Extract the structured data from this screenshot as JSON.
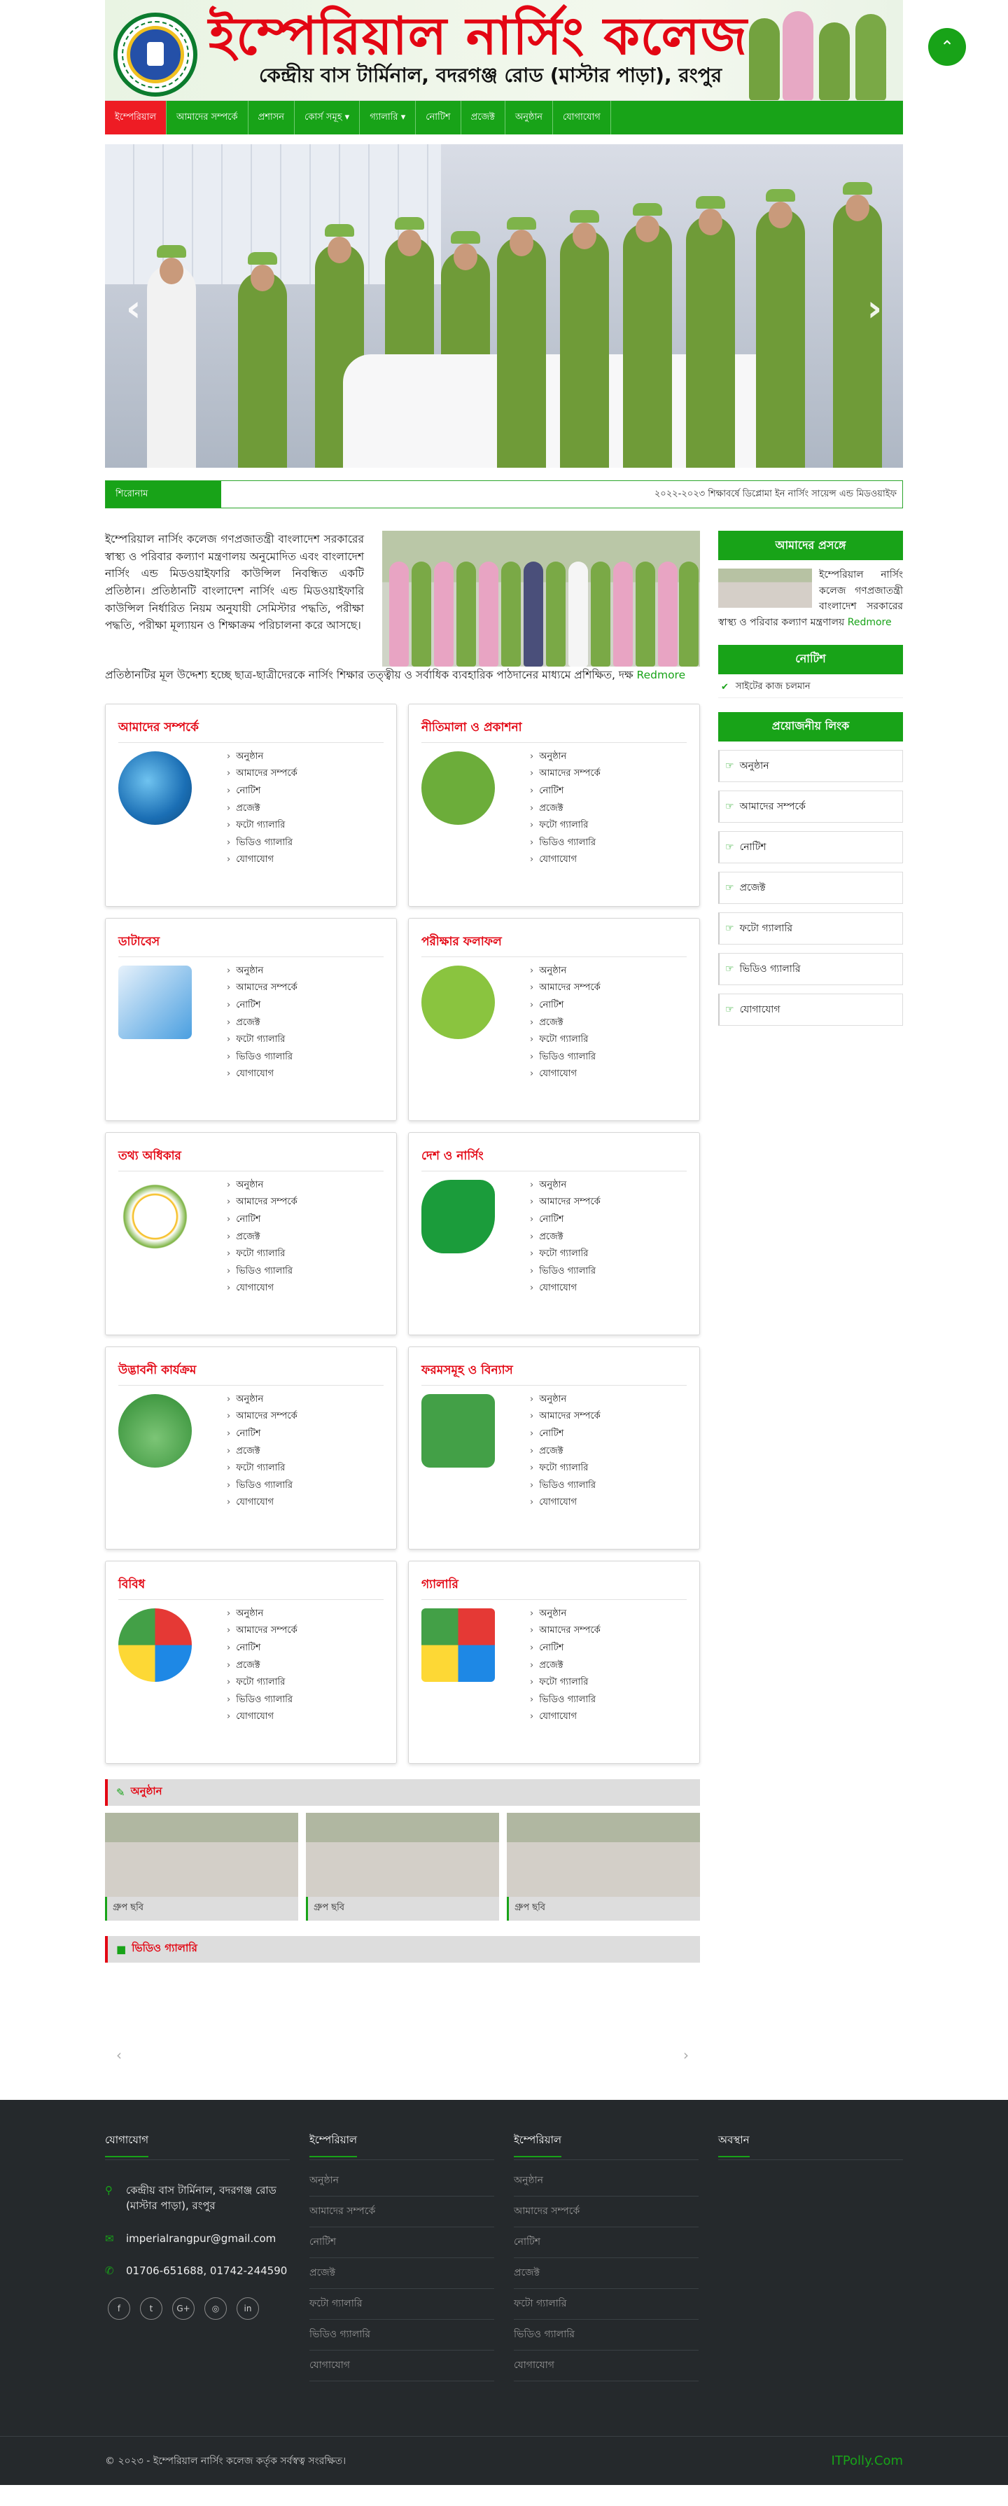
{
  "header": {
    "title": "ইম্পেরিয়াল নার্সিং কলেজ",
    "subtitle": "কেন্দ্রীয় বাস টার্মিনাল, বদরগঞ্জ রোড (মাস্টার পাড়া), রংপুর"
  },
  "nav": {
    "items": [
      "ইম্পেরিয়াল",
      "আমাদের সম্পর্কে",
      "প্রশাসন",
      "কোর্স সমূহ ▾",
      "গ্যালারি ▾",
      "নোটিশ",
      "প্রজেক্ট",
      "অনুষ্ঠান",
      "যোগাযোগ"
    ]
  },
  "slider": {
    "prev": "‹",
    "next": "›"
  },
  "ticker": {
    "label": "শিরোনাম",
    "text": "২০২২-২০২৩ শিক্ষাবর্ষে ডিপ্লোমা ইন নার্সিং সায়েন্স এন্ড মিডওয়াইফ"
  },
  "intro": {
    "text": "ইম্পেরিয়াল নার্সিং কলেজ গণপ্রজাতন্ত্রী বাংলাদেশ সরকারের স্বাস্থ্য ও পরিবার কল্যাণ মন্ত্রণালয় অনুমোদিত এবং বাংলাদেশ নার্সিং এন্ড মিডওয়াইফারি কাউন্সিল নিবন্ধিত একটি প্রতিষ্ঠান। প্রতিষ্ঠানটি বাংলাদেশ নার্সিং এন্ড মিডওয়াইফারি কাউন্সিল নির্ধারিত নিয়ম অনুযায়ী সেমিস্টার পদ্ধতি, পরীক্ষা পদ্ধতি, পরীক্ষা মূল্যায়ন ও শিক্ষাক্রম পরিচালনা করে আসছে।",
    "tail": "প্রতিষ্ঠানটির মূল উদ্দেশ্য হচ্ছে ছাত্র-ছাত্রীদেরকে নার্সিং শিক্ষার তত্ত্বীয় ও সর্বাধিক ব্যবহারিক পাঠদানের মাধ্যমে প্রশিক্ষিত, দক্ষ",
    "more": "Redmore"
  },
  "boxes": [
    {
      "title": "আমাদের সম্পর্কে",
      "icon": "globe-document-icon"
    },
    {
      "title": "নীতিমালা ও প্রকাশনা",
      "icon": "growth-chart-icon"
    },
    {
      "title": "ডাটাবেস",
      "icon": "email-icon"
    },
    {
      "title": "পরীক্ষার ফলাফল",
      "icon": "support-people-icon"
    },
    {
      "title": "তথ্য অধিকার",
      "icon": "idea-bulb-icon"
    },
    {
      "title": "দেশ ও নার্সিং",
      "icon": "bangladesh-map-icon"
    },
    {
      "title": "উদ্ভাবনী কার্যক্রম",
      "icon": "plant-icon"
    },
    {
      "title": "ফরমসমূহ ও বিন্যাস",
      "icon": "shield-emblem-icon"
    },
    {
      "title": "বিবিধ",
      "icon": "gears-team-icon"
    },
    {
      "title": "গ্যালারি",
      "icon": "puzzle-icon"
    }
  ],
  "box_links": [
    "অনুষ্ঠান",
    "আমাদের সম্পর্কে",
    "নোটিশ",
    "প্রজেক্ট",
    "ফটো গ্যালারি",
    "ভিডিও গ্যালারি",
    "যোগাযোগ"
  ],
  "events": {
    "heading": "অনুষ্ঠান",
    "items": [
      {
        "caption": "গ্রুপ ছবি"
      },
      {
        "caption": "গ্রুপ ছবি"
      },
      {
        "caption": "গ্রুপ ছবি"
      }
    ]
  },
  "video": {
    "heading": "ভিডিও গ্যালারি",
    "prev": "‹",
    "next": "›"
  },
  "sidebar": {
    "about_heading": "আমাদের প্রসঙ্গে",
    "about_text": "ইম্পেরিয়াল নার্সিং কলেজ গণপ্রজাতন্ত্রী বাংলাদেশ সরকারের স্বাস্থ্য ও পরিবার কল্যাণ মন্ত্রণালয়",
    "about_more": "Redmore",
    "notice_heading": "নোটিশ",
    "notice_item": "সাইটের কাজ চলমান",
    "links_heading": "প্রয়োজনীয় লিংক",
    "links": [
      "অনুষ্ঠান",
      "আমাদের সম্পর্কে",
      "নোটিশ",
      "প্রজেক্ট",
      "ফটো গ্যালারি",
      "ভিডিও গ্যালারি",
      "যোগাযোগ"
    ]
  },
  "footer": {
    "contact_heading": "যোগাযোগ",
    "address": "কেন্দ্রীয় বাস টার্মিনাল, বদরগঞ্জ রোড (মাস্টার পাড়া), রংপুর",
    "email": "imperialrangpur@gmail.com",
    "phone": "01706-651688, 01742-244590",
    "social": [
      "f",
      "t",
      "G+",
      "◎",
      "in"
    ],
    "col2_heading": "ইম্পেরিয়াল",
    "col3_heading": "ইম্পেরিয়াল",
    "col4_heading": "অবস্থান",
    "links": [
      "অনুষ্ঠান",
      "আমাদের সম্পর্কে",
      "নোটিশ",
      "প্রজেক্ট",
      "ফটো গ্যালারি",
      "ভিডিও গ্যালারি",
      "যোগাযোগ"
    ],
    "copyright": "© ২০২৩ - ইম্পেরিয়াল নার্সিং কলেজ কর্তৃক সর্বস্বত্ব সংরক্ষিত।",
    "credit": "ITPolly.Com"
  },
  "fab": "⌃",
  "colors": {
    "brand_green": "#18a318",
    "accent_red": "#e30613",
    "footer_bg": "#25292c"
  }
}
